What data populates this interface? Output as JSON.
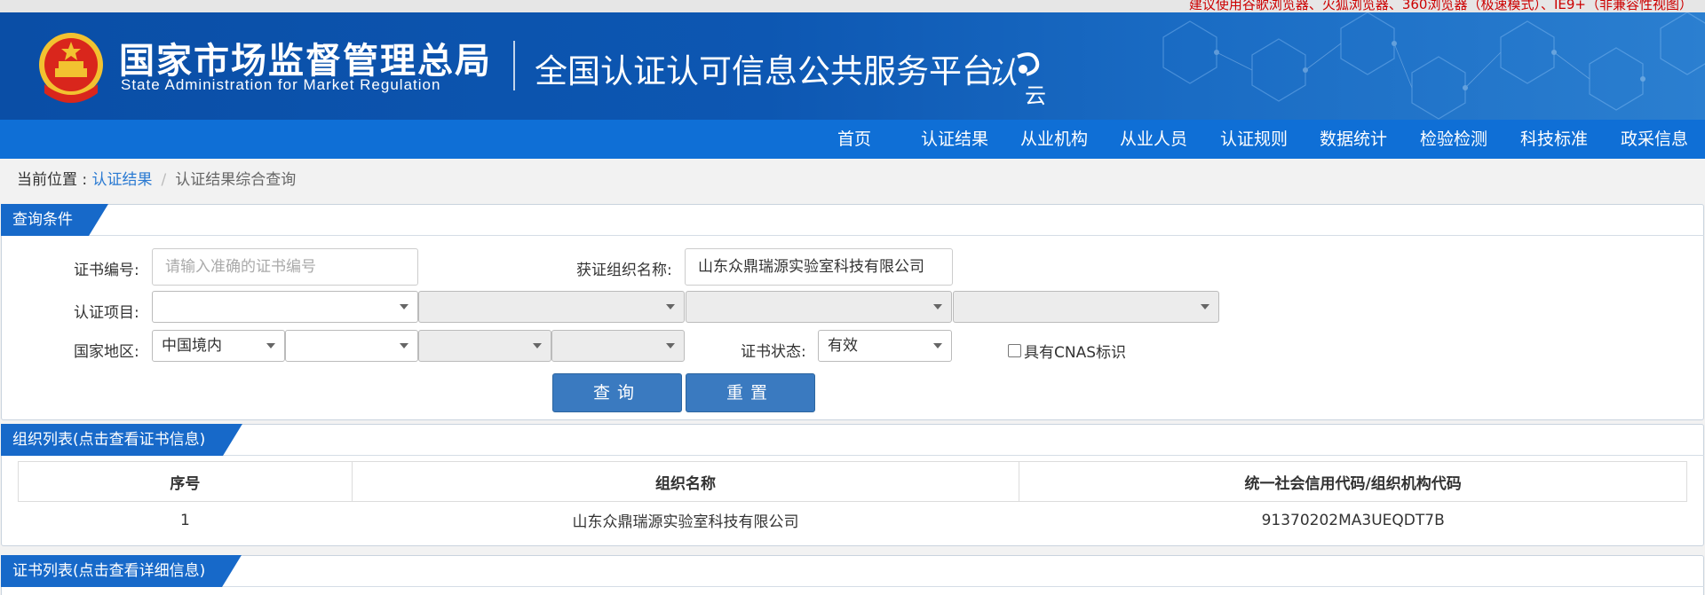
{
  "browser_tip": "建议使用谷歌浏览器、火狐浏览器、360浏览器（极速模式）、IE9+（非兼容性视图）",
  "header": {
    "org_name_cn": "国家市场监督管理总局",
    "org_name_en": "State Administration  for  Market Regulation",
    "platform_title": "全国认证认可信息公共服务平台",
    "logo_text": "认云"
  },
  "nav": {
    "items": [
      {
        "label": "首页"
      },
      {
        "label": "认证结果"
      },
      {
        "label": "从业机构"
      },
      {
        "label": "从业人员"
      },
      {
        "label": "认证规则"
      },
      {
        "label": "数据统计"
      },
      {
        "label": "检验检测"
      },
      {
        "label": "科技标准"
      },
      {
        "label": "政采信息"
      }
    ]
  },
  "breadcrumb": {
    "prefix": "当前位置 : ",
    "link": "认证结果",
    "separator": "/",
    "current": "认证结果综合查询"
  },
  "query_panel": {
    "title": "查询条件",
    "cert_no_label": "证书编号:",
    "cert_no_placeholder": "请输入准确的证书编号",
    "org_name_label": "获证组织名称:",
    "org_name_value": "山东众鼎瑞源实验室科技有限公司",
    "project_label": "认证项目:",
    "region_label": "国家地区:",
    "region_value": "中国境内",
    "status_label": "证书状态:",
    "status_value": "有效",
    "cnas_label": "具有CNAS标识",
    "search_button": "查询",
    "reset_button": "重置"
  },
  "org_panel": {
    "title": "组织列表(点击查看证书信息)",
    "columns": [
      "序号",
      "组织名称",
      "统一社会信用代码/组织机构代码"
    ],
    "rows": [
      [
        "1",
        "山东众鼎瑞源实验室科技有限公司",
        "91370202MA3UEQDT7B"
      ]
    ]
  },
  "cert_panel": {
    "title": "证书列表(点击查看详细信息)"
  },
  "colors": {
    "header_blue": "#0d57b2",
    "nav_blue": "#0f6fd6",
    "tab_blue": "#1769c9",
    "button_blue": "#3a7ac0",
    "tip_red": "#cc0000",
    "link_blue": "#2a7ad2"
  }
}
